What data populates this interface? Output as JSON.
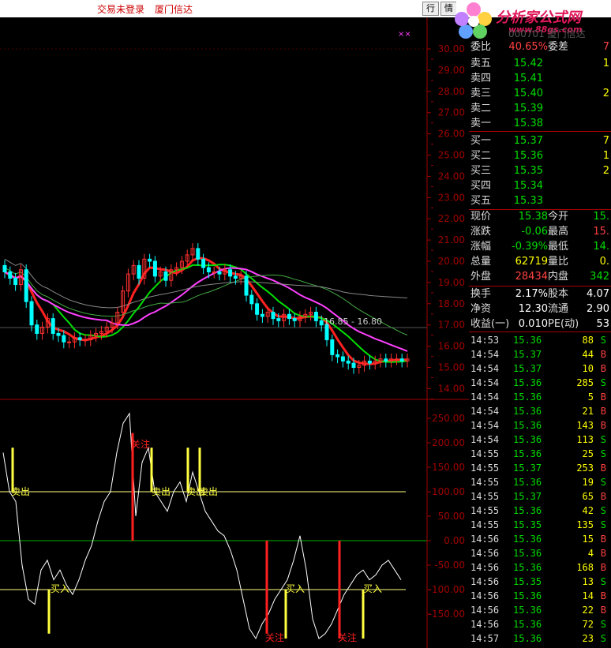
{
  "topbar": {
    "trade_status": "交易未登录",
    "broker": "厦门信达",
    "btn_hang": "行",
    "btn_qing": "情"
  },
  "logo": {
    "name": "分析家公式网",
    "url": "www.88gs.com"
  },
  "quote_header": {
    "partial_code": "000701 厦门信达"
  },
  "order_book_top": {
    "label": "委比",
    "value": "40.65%",
    "label2": "委差",
    "value2": "7"
  },
  "asks": [
    {
      "label": "卖五",
      "price": "15.42",
      "vol": "1"
    },
    {
      "label": "卖四",
      "price": "15.41",
      "vol": ""
    },
    {
      "label": "卖三",
      "price": "15.40",
      "vol": "2"
    },
    {
      "label": "卖二",
      "price": "15.39",
      "vol": ""
    },
    {
      "label": "卖一",
      "price": "15.38",
      "vol": ""
    }
  ],
  "bids": [
    {
      "label": "买一",
      "price": "15.37",
      "vol": "7"
    },
    {
      "label": "买二",
      "price": "15.36",
      "vol": "1"
    },
    {
      "label": "买三",
      "price": "15.35",
      "vol": "2"
    },
    {
      "label": "买四",
      "price": "15.34",
      "vol": ""
    },
    {
      "label": "买五",
      "price": "15.33",
      "vol": ""
    }
  ],
  "stats": [
    {
      "l1": "现价",
      "v1": "15.38",
      "c1": "green",
      "l2": "今开",
      "v2": "15.",
      "c2": "green"
    },
    {
      "l1": "涨跌",
      "v1": "-0.06",
      "c1": "green",
      "l2": "最高",
      "v2": "15.",
      "c2": "red"
    },
    {
      "l1": "涨幅",
      "v1": "-0.39%",
      "c1": "green",
      "l2": "最低",
      "v2": "14.",
      "c2": "green"
    },
    {
      "l1": "总量",
      "v1": "62719",
      "c1": "yellow",
      "l2": "量比",
      "v2": "0.",
      "c2": "yellow"
    },
    {
      "l1": "外盘",
      "v1": "28434",
      "c1": "red",
      "l2": "内盘",
      "v2": "342",
      "c2": "green"
    }
  ],
  "stats2": [
    {
      "l1": "换手",
      "v1": "2.17%",
      "c1": "white",
      "l2": "股本",
      "v2": "4.07",
      "c2": "white"
    },
    {
      "l1": "净资",
      "v1": "12.30",
      "c1": "white",
      "l2": "流通",
      "v2": "2.90",
      "c2": "white"
    },
    {
      "l1": "收益(一)",
      "v1": "0.010",
      "c1": "white",
      "l2": "PE(动)",
      "v2": "53",
      "c2": "white"
    }
  ],
  "ticks": [
    {
      "t": "14:53",
      "p": "15.36",
      "v": "88",
      "s": "S"
    },
    {
      "t": "14:54",
      "p": "15.37",
      "v": "44",
      "s": "B"
    },
    {
      "t": "14:54",
      "p": "15.37",
      "v": "10",
      "s": "B"
    },
    {
      "t": "14:54",
      "p": "15.36",
      "v": "285",
      "s": "S"
    },
    {
      "t": "14:54",
      "p": "15.36",
      "v": "5",
      "s": "B"
    },
    {
      "t": "14:54",
      "p": "15.36",
      "v": "21",
      "s": "B"
    },
    {
      "t": "14:54",
      "p": "15.36",
      "v": "143",
      "s": "B"
    },
    {
      "t": "14:54",
      "p": "15.36",
      "v": "113",
      "s": "S"
    },
    {
      "t": "14:55",
      "p": "15.36",
      "v": "25",
      "s": "S"
    },
    {
      "t": "14:55",
      "p": "15.37",
      "v": "253",
      "s": "B"
    },
    {
      "t": "14:55",
      "p": "15.36",
      "v": "19",
      "s": "S"
    },
    {
      "t": "14:55",
      "p": "15.37",
      "v": "65",
      "s": "B"
    },
    {
      "t": "14:55",
      "p": "15.36",
      "v": "42",
      "s": "S"
    },
    {
      "t": "14:55",
      "p": "15.35",
      "v": "135",
      "s": "S"
    },
    {
      "t": "14:56",
      "p": "15.36",
      "v": "15",
      "s": "B"
    },
    {
      "t": "14:56",
      "p": "15.36",
      "v": "4",
      "s": "B"
    },
    {
      "t": "14:56",
      "p": "15.36",
      "v": "168",
      "s": "B"
    },
    {
      "t": "14:56",
      "p": "15.35",
      "v": "13",
      "s": "S"
    },
    {
      "t": "14:56",
      "p": "15.36",
      "v": "14",
      "s": "B"
    },
    {
      "t": "14:56",
      "p": "15.36",
      "v": "22",
      "s": "B"
    },
    {
      "t": "14:56",
      "p": "15.36",
      "v": "72",
      "s": "S"
    },
    {
      "t": "14:57",
      "p": "15.36",
      "v": "23",
      "s": "S"
    }
  ],
  "price_axis": [
    "30.00",
    "29.00",
    "28.00",
    "27.00",
    "26.00",
    "25.00",
    "24.00",
    "23.00",
    "22.00",
    "21.00",
    "20.00",
    "19.00",
    "18.00",
    "17.00",
    "16.00",
    "15.00",
    "14.00"
  ],
  "indicator_axis": [
    "250.00",
    "200.00",
    "150.00",
    "100.00",
    "50.00",
    "0.00",
    "-50.00",
    "-100.00",
    "-150.00"
  ],
  "chart_annotations": {
    "range_label": "16.85 - 16.80",
    "signal_labels": [
      "卖出",
      "卖出",
      "卖出",
      "卖出",
      "买入",
      "买入",
      "买入",
      "关注",
      "关注",
      "关注"
    ],
    "corner_marks": "××"
  },
  "colors": {
    "up": "#ff3030",
    "down": "#00ffff",
    "ma_green": "#00e000",
    "ma_magenta": "#ff40ff",
    "ma_red": "#ff2020",
    "axis": "#a00000",
    "signal_yellow": "#ffff40",
    "signal_red": "#ff2020"
  }
}
